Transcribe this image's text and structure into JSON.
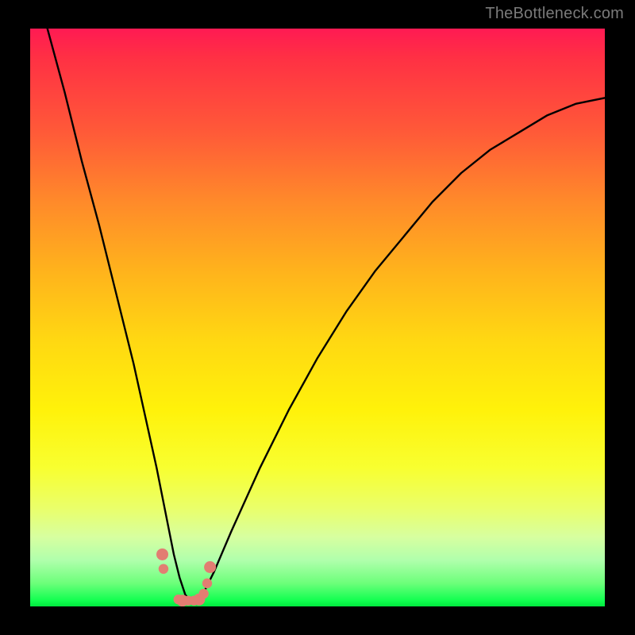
{
  "watermark": {
    "text": "TheBottleneck.com"
  },
  "colors": {
    "background": "#000000",
    "curve": "#000000",
    "markers": "#e27d72",
    "gradient_top": "#ff1a53",
    "gradient_bottom": "#00e83e"
  },
  "chart_data": {
    "type": "line",
    "title": "",
    "xlabel": "",
    "ylabel": "",
    "xlim": [
      0,
      100
    ],
    "ylim": [
      0,
      100
    ],
    "grid": false,
    "legend": false,
    "x": [
      0,
      3,
      6,
      9,
      12,
      15,
      18,
      20,
      22,
      24,
      25,
      26,
      27,
      28,
      29,
      30,
      32,
      35,
      40,
      45,
      50,
      55,
      60,
      65,
      70,
      75,
      80,
      85,
      90,
      95,
      100
    ],
    "values": [
      null,
      100,
      89,
      77,
      66,
      54,
      42,
      33,
      24,
      14,
      9,
      5,
      2,
      1,
      1,
      2,
      6,
      13,
      24,
      34,
      43,
      51,
      58,
      64,
      70,
      75,
      79,
      82,
      85,
      87,
      88
    ],
    "markers": {
      "x": [
        23.0,
        23.2,
        25.8,
        26.5,
        27.5,
        28.5,
        29.4,
        30.2,
        30.8,
        31.3
      ],
      "y": [
        9.0,
        6.5,
        1.2,
        1.0,
        1.0,
        1.0,
        1.2,
        2.2,
        4.0,
        6.8
      ]
    },
    "notes": "Gradient background encodes score quality (green=good near bottom, red=bad near top). Curve is a V-shaped bottleneck curve with minimum near x≈28. Salmon-colored dots cluster at the valley floor."
  }
}
